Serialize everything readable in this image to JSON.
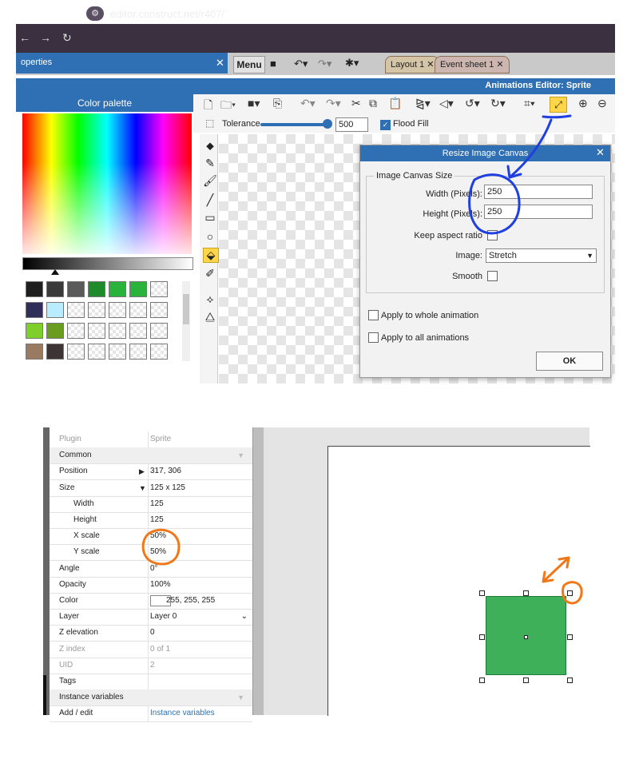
{
  "browser": {
    "url": "editor.construct.net/r407/"
  },
  "panels": {
    "properties_tab": "operties",
    "menu_label": "Menu",
    "tabs": [
      "Layout 1",
      "Event sheet 1"
    ],
    "editor_title": "Animations Editor: Sprite",
    "palette_title": "Color palette"
  },
  "toolbar": {
    "tolerance_label": "Tolerance",
    "tolerance_value": "500",
    "tolerance_level_percent": 100,
    "flood_fill_label": "Flood Fill",
    "flood_fill_checked": true
  },
  "palette": {
    "swatches": [
      [
        "#1f1f1f",
        "#3a3a3a",
        "#5a5a5a",
        "#1e8a2c",
        "#2ab33a",
        "#2ab33a",
        "empty"
      ],
      [
        "#2f2f5a",
        "#b9ecff",
        "empty",
        "empty",
        "empty",
        "empty",
        "empty"
      ],
      [
        "#7fcf2a",
        "#6a9c20",
        "empty",
        "empty",
        "empty",
        "empty",
        "empty"
      ],
      [
        "#9b7a62",
        "#3d3535",
        "empty",
        "empty",
        "empty",
        "empty",
        "empty"
      ]
    ]
  },
  "dialog": {
    "title": "Resize Image Canvas",
    "group_label": "Image Canvas Size",
    "width_label": "Width (Pixels):",
    "width_value": "250",
    "height_label": "Height (Pixels):",
    "height_value": "250",
    "keep_aspect_label": "Keep aspect ratio",
    "image_label": "Image:",
    "image_value": "Stretch",
    "smooth_label": "Smooth",
    "apply_whole_label": "Apply to whole animation",
    "apply_all_label": "Apply to all animations",
    "ok_label": "OK"
  },
  "properties": {
    "rows": [
      {
        "name": "Plugin",
        "value": "Sprite",
        "dim": true
      },
      {
        "name": "Common",
        "value": "",
        "section": true
      },
      {
        "name": "Position",
        "value": "317, 306",
        "arrow": "right"
      },
      {
        "name": "Size",
        "value": "125 x 125",
        "arrow": "down"
      },
      {
        "name": "Width",
        "value": "125",
        "sub": true
      },
      {
        "name": "Height",
        "value": "125",
        "sub": true
      },
      {
        "name": "X scale",
        "value": "50%",
        "sub": true
      },
      {
        "name": "Y scale",
        "value": "50%",
        "sub": true
      },
      {
        "name": "Angle",
        "value": "0°"
      },
      {
        "name": "Opacity",
        "value": "100%"
      },
      {
        "name": "Color",
        "value": "255, 255, 255",
        "color_swatch": "#ffffff"
      },
      {
        "name": "Layer",
        "value": "Layer 0",
        "dropdown": true
      },
      {
        "name": "Z elevation",
        "value": "0"
      },
      {
        "name": "Z index",
        "value": "0 of 1",
        "dim": true
      },
      {
        "name": "UID",
        "value": "2",
        "dim": true
      },
      {
        "name": "Tags",
        "value": ""
      },
      {
        "name": "Instance variables",
        "value": "",
        "section": true
      },
      {
        "name": "Add / edit",
        "value": "Instance variables",
        "link": true
      }
    ]
  },
  "colors": {
    "accent": "#2f6fb3",
    "sprite_fill": "#3fb05a",
    "annotation_blue": "#1f3fe0",
    "annotation_orange": "#f07818"
  }
}
